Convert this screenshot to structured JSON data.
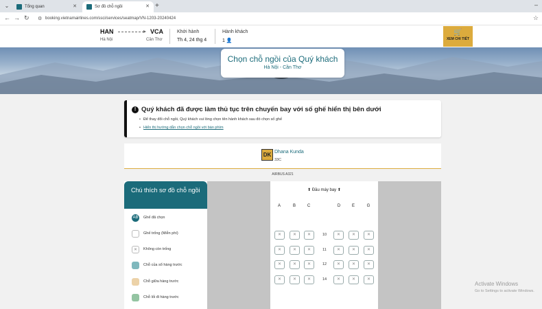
{
  "browser": {
    "tabs": [
      {
        "label": "Tổng quan"
      },
      {
        "label": "Sơ đồ chỗ ngồi"
      }
    ],
    "url": "booking.vietnamairlines.com/ssci/services/seatmap/VN-1203-20240424"
  },
  "flight": {
    "origin_code": "HAN",
    "origin_city": "Hà Nội",
    "dest_code": "VCA",
    "dest_city": "Cần Thơ",
    "depart_label": "Khởi hành",
    "depart_value": "Th 4, 24 thg 4",
    "pax_label": "Hành khách",
    "pax_value": "1",
    "detail_button": "XEM CHI TIẾT"
  },
  "hero": {
    "title": "Chọn chỗ ngồi của Quý khách",
    "subtitle": "Hà Nội - Cần Thơ"
  },
  "notice": {
    "title": "Quý khách đã được làm thủ tục trên chuyến bay với số ghế hiển thị bên dưới",
    "line1": "Để thay đổi chỗ ngồi, Quý khách vui lòng chọn tên hành khách sau đó chọn số ghế",
    "link": "Hiển thị hướng dẫn chọn chỗ ngồi với bàn phím"
  },
  "passenger": {
    "initials": "DK",
    "name": "Dhana Kunda",
    "seat": "33C"
  },
  "aircraft": "AIRBUS A321",
  "legend": {
    "title": "Chú thích sơ đồ chỗ ngồi",
    "items": [
      {
        "label": "Ghế đã chọn",
        "swatch_text": "AB",
        "color": "#1b6b7a"
      },
      {
        "label": "Ghế trống (Miễn phí)",
        "color": "#ffffff"
      },
      {
        "label": "Không còn trống",
        "color": "#ffffff"
      },
      {
        "label": "Chỗ của sổ hàng trước",
        "color": "#7fb8bd"
      },
      {
        "label": "Chỗ giữa hàng trước",
        "color": "#ecd2a8"
      },
      {
        "label": "Chỗ lối đi hàng trước",
        "color": "#94c4a2"
      }
    ]
  },
  "seatmap": {
    "front_label": "Đầu máy bay",
    "columns": [
      "A",
      "B",
      "C",
      "D",
      "E",
      "G"
    ],
    "rows": [
      "10",
      "11",
      "12",
      "14"
    ]
  },
  "watermark": {
    "title": "Activate Windows",
    "sub": "Go to Settings to activate Windows."
  }
}
